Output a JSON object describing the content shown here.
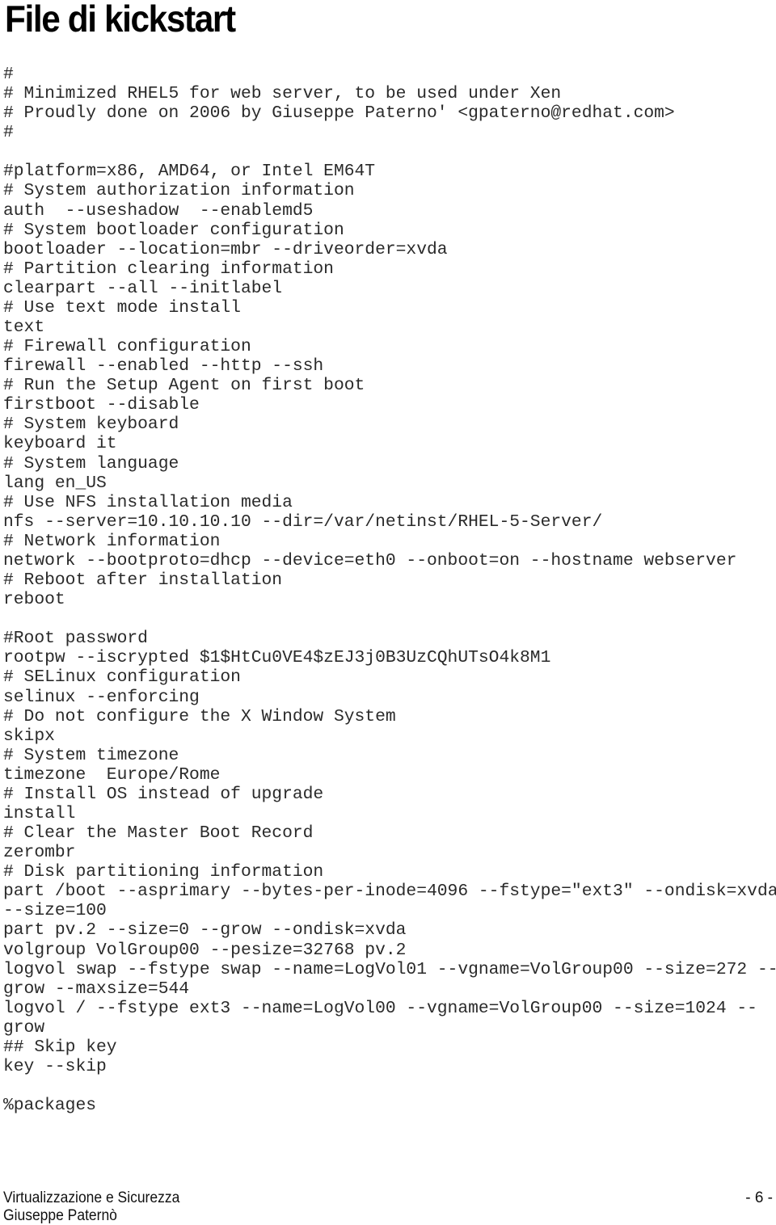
{
  "page": {
    "title": "File di kickstart",
    "code_lines": [
      "#",
      "# Minimized RHEL5 for web server, to be used under Xen",
      "# Proudly done on 2006 by Giuseppe Paterno' <gpaterno@redhat.com>",
      "#",
      "",
      "#platform=x86, AMD64, or Intel EM64T",
      "# System authorization information",
      "auth  --useshadow  --enablemd5",
      "# System bootloader configuration",
      "bootloader --location=mbr --driveorder=xvda",
      "# Partition clearing information",
      "clearpart --all --initlabel",
      "# Use text mode install",
      "text",
      "# Firewall configuration",
      "firewall --enabled --http --ssh",
      "# Run the Setup Agent on first boot",
      "firstboot --disable",
      "# System keyboard",
      "keyboard it",
      "# System language",
      "lang en_US",
      "# Use NFS installation media",
      "nfs --server=10.10.10.10 --dir=/var/netinst/RHEL-5-Server/",
      "# Network information",
      "network --bootproto=dhcp --device=eth0 --onboot=on --hostname webserver",
      "# Reboot after installation",
      "reboot",
      "",
      "#Root password",
      "rootpw --iscrypted $1$HtCu0VE4$zEJ3j0B3UzCQhUTsO4k8M1",
      "# SELinux configuration",
      "selinux --enforcing",
      "# Do not configure the X Window System",
      "skipx",
      "# System timezone",
      "timezone  Europe/Rome",
      "# Install OS instead of upgrade",
      "install",
      "# Clear the Master Boot Record",
      "zerombr",
      "# Disk partitioning information",
      "part /boot --asprimary --bytes-per-inode=4096 --fstype=\"ext3\" --ondisk=xvda",
      "--size=100",
      "part pv.2 --size=0 --grow --ondisk=xvda",
      "volgroup VolGroup00 --pesize=32768 pv.2",
      "logvol swap --fstype swap --name=LogVol01 --vgname=VolGroup00 --size=272 --",
      "grow --maxsize=544",
      "logvol / --fstype ext3 --name=LogVol00 --vgname=VolGroup00 --size=1024 --",
      "grow",
      "## Skip key",
      "key --skip",
      "",
      "%packages"
    ]
  },
  "footer": {
    "course": "Virtualizzazione e Sicurezza",
    "author": "Giuseppe Paternò",
    "page_number": "- 6 -"
  }
}
